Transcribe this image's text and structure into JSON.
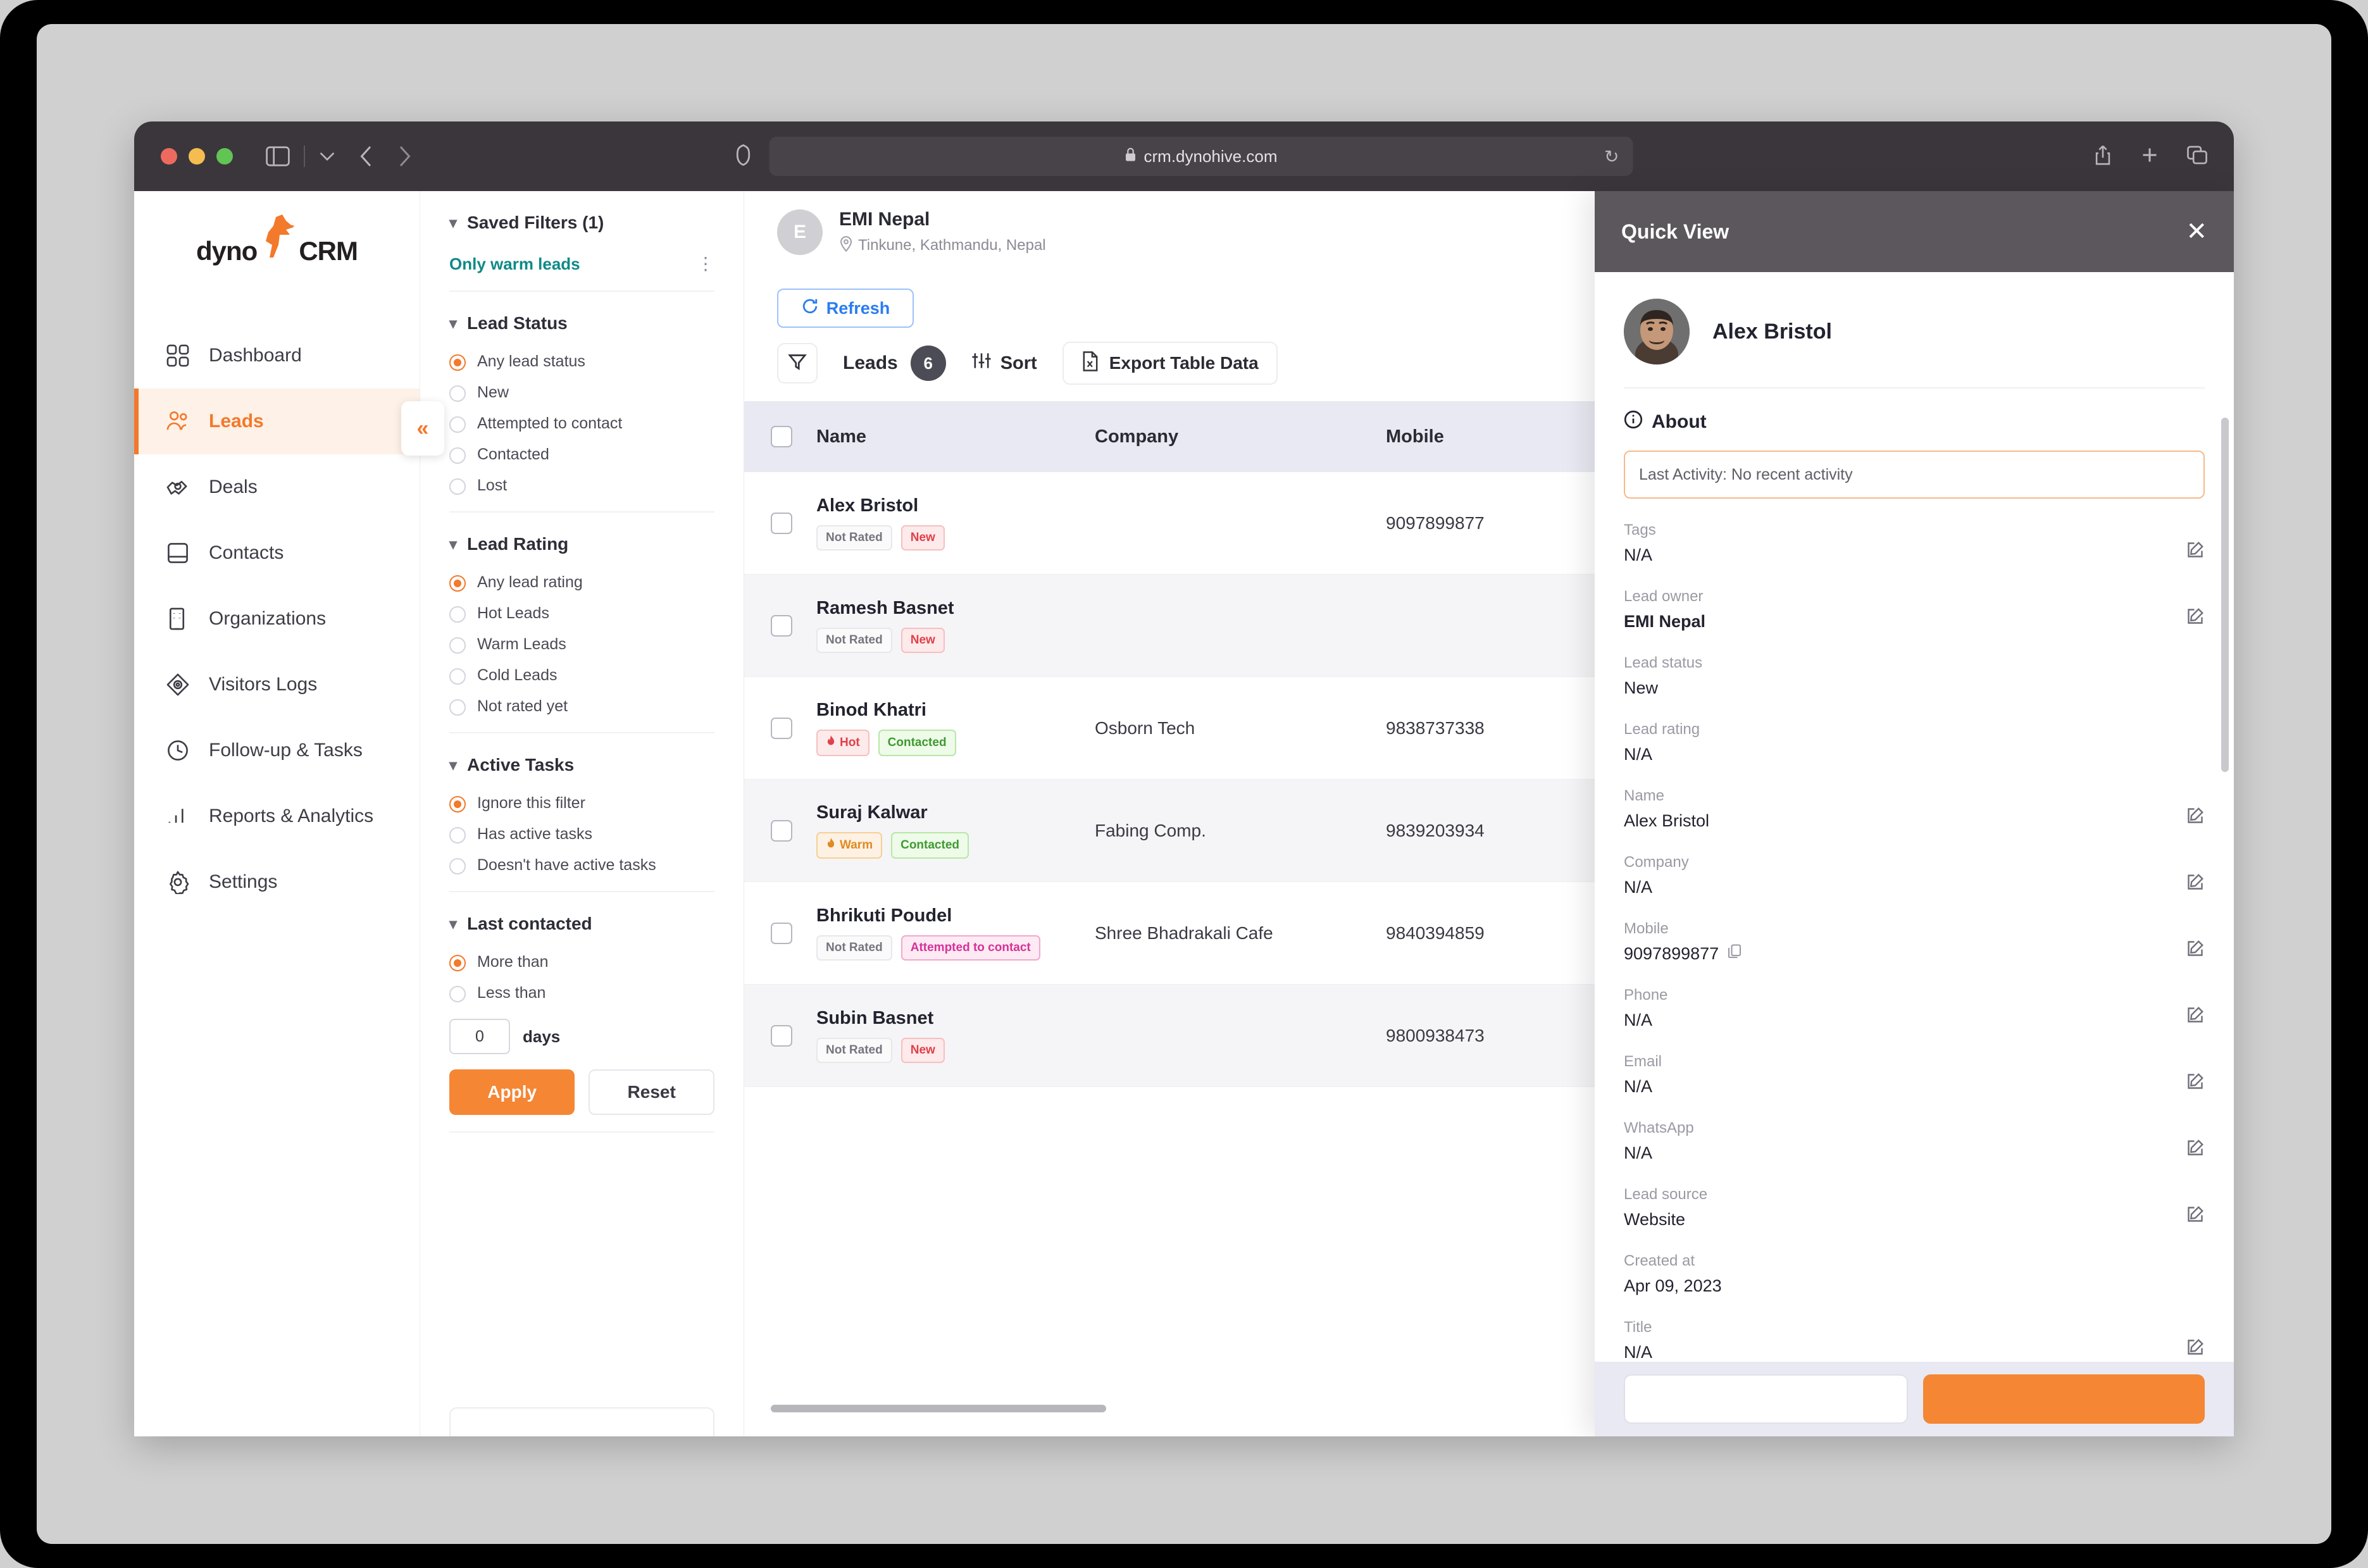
{
  "browser": {
    "url": "crm.dynohive.com",
    "lock_icon": "lock-icon",
    "reload_icon": "reload-icon"
  },
  "brand": {
    "logo_text_1": "dyno",
    "logo_text_2": "CRM",
    "accent": "#f3792b"
  },
  "sidebar": {
    "items": [
      {
        "label": "Dashboard",
        "icon": "dashboard-icon",
        "active": false
      },
      {
        "label": "Leads",
        "icon": "leads-icon",
        "active": true
      },
      {
        "label": "Deals",
        "icon": "deals-icon",
        "active": false
      },
      {
        "label": "Contacts",
        "icon": "contacts-icon",
        "active": false
      },
      {
        "label": "Organizations",
        "icon": "organizations-icon",
        "active": false
      },
      {
        "label": "Visitors Logs",
        "icon": "visitors-icon",
        "active": false
      },
      {
        "label": "Follow-up & Tasks",
        "icon": "clock-icon",
        "active": false
      },
      {
        "label": "Reports & Analytics",
        "icon": "bar-chart-icon",
        "active": false
      },
      {
        "label": "Settings",
        "icon": "gear-icon",
        "active": false
      }
    ],
    "collapse_glyph": "«"
  },
  "filters": {
    "saved": {
      "title": "Saved Filters (1)",
      "item": "Only warm leads",
      "color": "#0e8a86"
    },
    "lead_status": {
      "title": "Lead Status",
      "options": [
        "Any lead status",
        "New",
        "Attempted to contact",
        "Contacted",
        "Lost"
      ],
      "selected": "Any lead status"
    },
    "lead_rating": {
      "title": "Lead Rating",
      "options": [
        "Any lead rating",
        "Hot Leads",
        "Warm Leads",
        "Cold Leads",
        "Not rated yet"
      ],
      "selected": "Any lead rating"
    },
    "active_tasks": {
      "title": "Active Tasks",
      "options": [
        "Ignore this filter",
        "Has active tasks",
        "Doesn't have active tasks"
      ],
      "selected": "Ignore this filter"
    },
    "last_contacted": {
      "title": "Last contacted",
      "options": [
        "More than",
        "Less than"
      ],
      "selected": "More than",
      "days_value": "0",
      "days_label": "days"
    },
    "apply_label": "Apply",
    "reset_label": "Reset"
  },
  "header": {
    "avatar_initial": "E",
    "org_name": "EMI Nepal",
    "org_location": "Tinkune, Kathmandu, Nepal",
    "location_icon": "map-pin-icon",
    "theme_toggle": "theme-toggle",
    "fullscreen_icon": "fullscreen-icon"
  },
  "toolbar": {
    "refresh_label": "Refresh",
    "refresh_icon": "refresh-icon",
    "filter_icon": "funnel-icon",
    "leads_label": "Leads",
    "leads_count": "6",
    "sort_label": "Sort",
    "sort_icon": "sliders-icon",
    "export_label": "Export Table Data",
    "export_icon": "file-export-icon"
  },
  "table": {
    "columns": [
      "Name",
      "Company",
      "Mobile"
    ],
    "rows": [
      {
        "name": "Alex Bristol",
        "company": "",
        "mobile": "9097899877",
        "badges": [
          {
            "text": "Not Rated",
            "type": "notrated"
          },
          {
            "text": "New",
            "type": "new"
          }
        ]
      },
      {
        "name": "Ramesh Basnet",
        "company": "",
        "mobile": "",
        "badges": [
          {
            "text": "Not Rated",
            "type": "notrated"
          },
          {
            "text": "New",
            "type": "new"
          }
        ]
      },
      {
        "name": "Binod Khatri",
        "company": "Osborn Tech",
        "mobile": "9838737338",
        "badges": [
          {
            "text": "Hot",
            "type": "hot",
            "icon": "flame-icon"
          },
          {
            "text": "Contacted",
            "type": "contacted"
          }
        ]
      },
      {
        "name": "Suraj Kalwar",
        "company": "Fabing Comp.",
        "mobile": "9839203934",
        "badges": [
          {
            "text": "Warm",
            "type": "warm",
            "icon": "flame-icon"
          },
          {
            "text": "Contacted",
            "type": "contacted"
          }
        ]
      },
      {
        "name": "Bhrikuti Poudel",
        "company": "Shree Bhadrakali Cafe",
        "mobile": "9840394859",
        "badges": [
          {
            "text": "Not Rated",
            "type": "notrated"
          },
          {
            "text": "Attempted to contact",
            "type": "attempted"
          }
        ]
      },
      {
        "name": "Subin Basnet",
        "company": "",
        "mobile": "9800938473",
        "badges": [
          {
            "text": "Not Rated",
            "type": "notrated"
          },
          {
            "text": "New",
            "type": "new"
          }
        ]
      }
    ]
  },
  "quick_view": {
    "title": "Quick View",
    "close_icon": "close-icon",
    "person_name": "Alex Bristol",
    "about_label": "About",
    "about_icon": "info-icon",
    "last_activity": "Last Activity: No recent activity",
    "fields": [
      {
        "label": "Tags",
        "value": "N/A",
        "bold": false,
        "edit": true,
        "copy": false
      },
      {
        "label": "Lead owner",
        "value": "EMI Nepal",
        "bold": true,
        "edit": true,
        "copy": false
      },
      {
        "label": "Lead status",
        "value": "New",
        "bold": false,
        "edit": false,
        "copy": false
      },
      {
        "label": "Lead rating",
        "value": "N/A",
        "bold": false,
        "edit": false,
        "copy": false
      },
      {
        "label": "Name",
        "value": "Alex Bristol",
        "bold": false,
        "edit": true,
        "copy": false
      },
      {
        "label": "Company",
        "value": "N/A",
        "bold": false,
        "edit": true,
        "copy": false
      },
      {
        "label": "Mobile",
        "value": "9097899877",
        "bold": false,
        "edit": true,
        "copy": true
      },
      {
        "label": "Phone",
        "value": "N/A",
        "bold": false,
        "edit": true,
        "copy": false
      },
      {
        "label": "Email",
        "value": "N/A",
        "bold": false,
        "edit": true,
        "copy": false
      },
      {
        "label": "WhatsApp",
        "value": "N/A",
        "bold": false,
        "edit": true,
        "copy": false
      },
      {
        "label": "Lead source",
        "value": "Website",
        "bold": false,
        "edit": true,
        "copy": false
      },
      {
        "label": "Created at",
        "value": "Apr 09, 2023",
        "bold": false,
        "edit": false,
        "copy": false
      },
      {
        "label": "Title",
        "value": "N/A",
        "bold": false,
        "edit": true,
        "copy": false
      }
    ]
  }
}
